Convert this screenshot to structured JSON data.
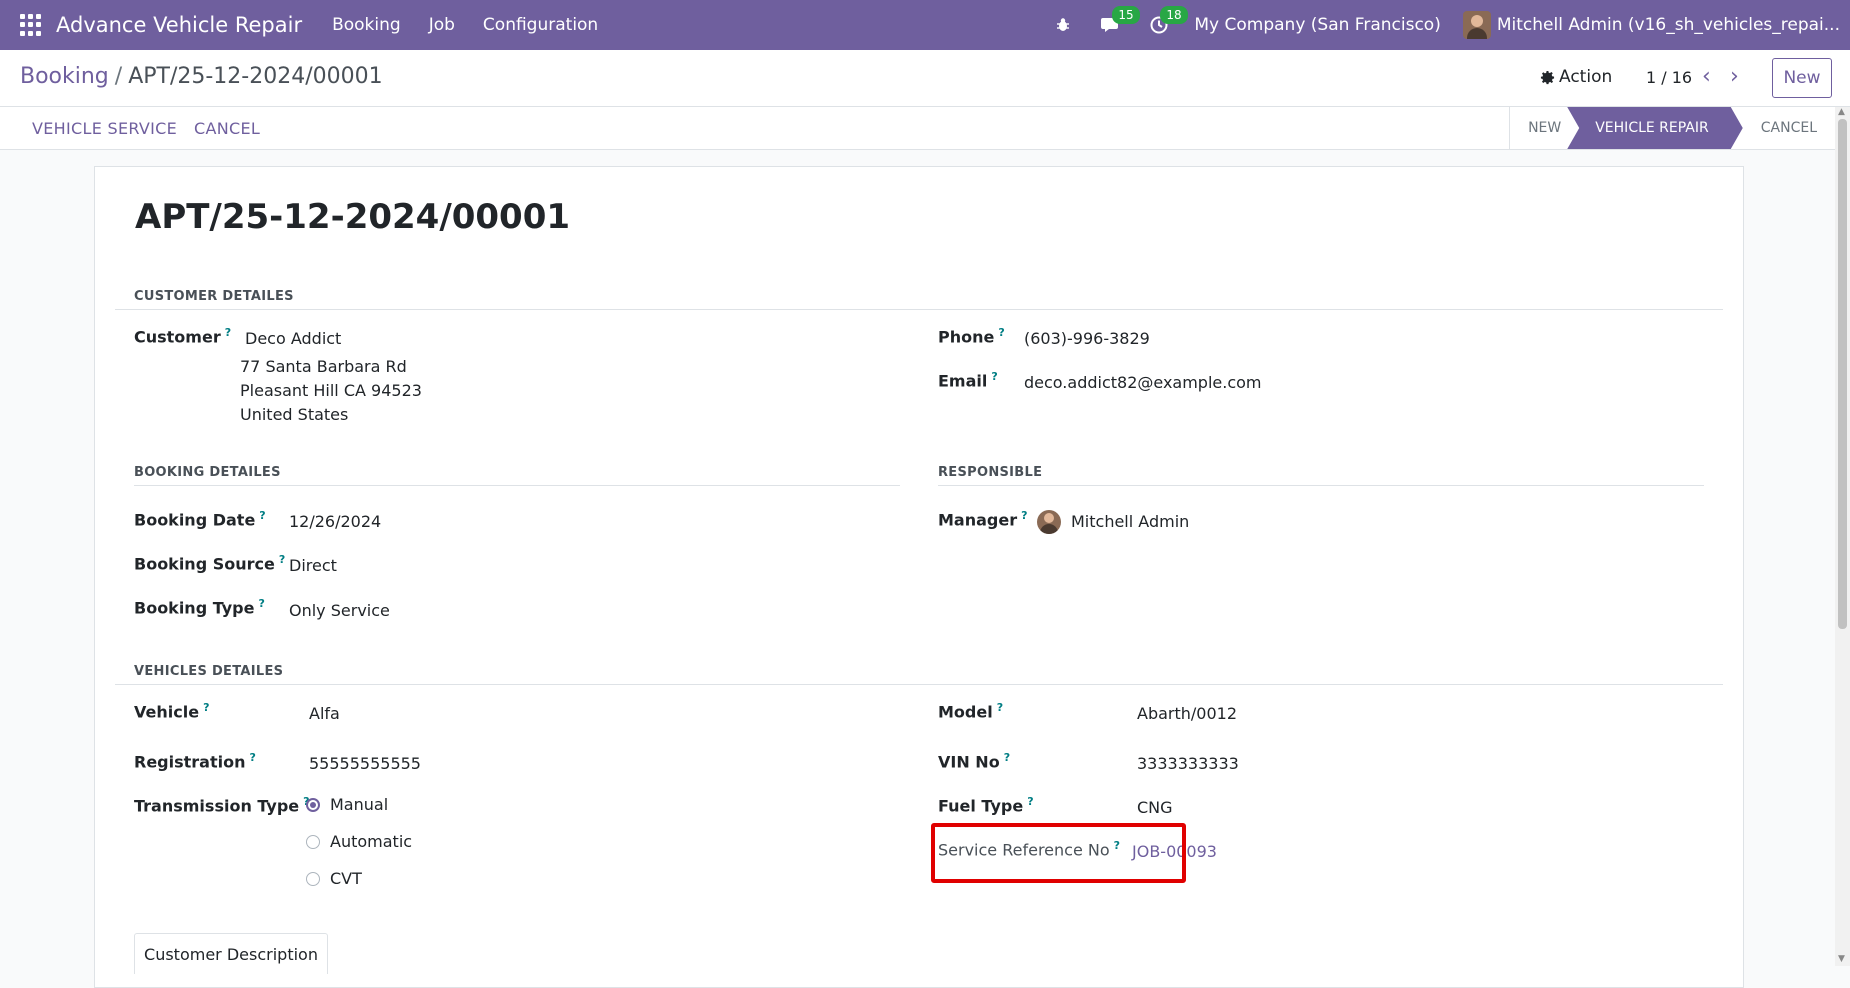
{
  "navbar": {
    "brand": "Advance Vehicle Repair",
    "menus": [
      "Booking",
      "Job",
      "Configuration"
    ],
    "messages_badge": "15",
    "activities_badge": "18",
    "company": "My Company (San Francisco)",
    "user": "Mitchell Admin (v16_sh_vehicles_repai..."
  },
  "control": {
    "breadcrumb_parent": "Booking",
    "breadcrumb_sep": "/",
    "breadcrumb_current": "APT/25-12-2024/00001",
    "action_label": "Action",
    "pager": "1 / 16",
    "new_label": "New"
  },
  "statusbar": {
    "buttons": [
      "VEHICLE SERVICE",
      "CANCEL"
    ],
    "stages": [
      "NEW",
      "VEHICLE REPAIR",
      "CANCEL"
    ],
    "active_stage": "VEHICLE REPAIR"
  },
  "form": {
    "title": "APT/25-12-2024/00001",
    "customer_section": "CUSTOMER DETAILES",
    "customer_label": "Customer",
    "customer_name": "Deco Addict",
    "customer_address_1": "77 Santa Barbara Rd",
    "customer_address_2": "Pleasant Hill CA 94523",
    "customer_address_3": "United States",
    "phone_label": "Phone",
    "phone": "(603)-996-3829",
    "email_label": "Email",
    "email": "deco.addict82@example.com",
    "booking_section": "BOOKING DETAILES",
    "booking_date_label": "Booking Date",
    "booking_date": "12/26/2024",
    "booking_source_label": "Booking Source",
    "booking_source": "Direct",
    "booking_type_label": "Booking Type",
    "booking_type": "Only Service",
    "responsible_section": "RESPONSIBLE",
    "manager_label": "Manager",
    "manager": "Mitchell Admin",
    "vehicles_section": "VEHICLES DETAILES",
    "vehicle_label": "Vehicle",
    "vehicle": "Alfa",
    "registration_label": "Registration",
    "registration": "55555555555",
    "transmission_label": "Transmission Type",
    "transmission_options": [
      "Manual",
      "Automatic",
      "CVT"
    ],
    "transmission_selected": "Manual",
    "model_label": "Model",
    "model": "Abarth/0012",
    "vin_label": "VIN No",
    "vin": "3333333333",
    "fuel_label": "Fuel Type",
    "fuel": "CNG",
    "service_ref_label": "Service Reference No",
    "service_ref": "JOB-00093",
    "tab_customer_description": "Customer Description"
  },
  "colors": {
    "brand": "#6f5f9e",
    "badge": "#28a745",
    "highlight": "#e00000"
  }
}
